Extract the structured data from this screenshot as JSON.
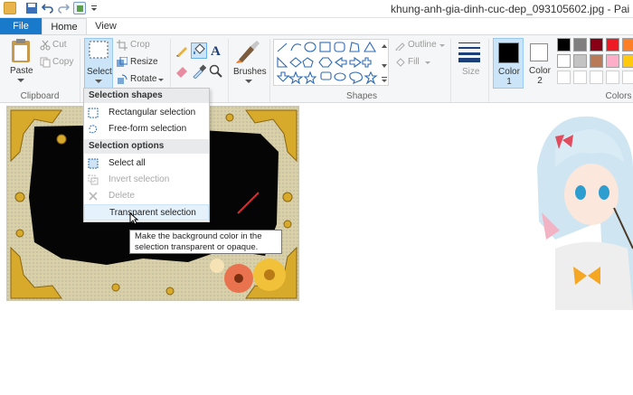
{
  "window": {
    "title": "khung-anh-gia-dinh-cuc-dep_093105602.jpg - Pai"
  },
  "tabs": {
    "file": "File",
    "home": "Home",
    "view": "View"
  },
  "clipboard": {
    "paste": "Paste",
    "cut": "Cut",
    "copy": "Copy",
    "group": "Clipboard"
  },
  "image": {
    "select": "Select",
    "crop": "Crop",
    "resize": "Resize",
    "rotate": "Rotate"
  },
  "tools": {
    "brushes": "Brushes"
  },
  "shapes": {
    "outline": "Outline",
    "fill": "Fill",
    "group": "Shapes"
  },
  "size": {
    "label": "Size"
  },
  "colors": {
    "color1": "Color 1",
    "color2": "Color 2",
    "group": "Colors",
    "swatches": [
      "#000000",
      "#7f7f7f",
      "#880015",
      "#ed1c24",
      "#ff7f27",
      "#fff200",
      "#ffffff",
      "#c3c3c3",
      "#b97a57",
      "#ffaec9",
      "#ffc90e",
      "#efe4b0"
    ]
  },
  "menu": {
    "shapes_header": "Selection shapes",
    "rect": "Rectangular selection",
    "freeform": "Free-form selection",
    "options_header": "Selection options",
    "select_all": "Select all",
    "invert": "Invert selection",
    "delete": "Delete",
    "transparent": "Transparent selection"
  },
  "tooltip": {
    "text": "Make the background color in the selection transparent or opaque."
  },
  "accent": "#1979ca"
}
